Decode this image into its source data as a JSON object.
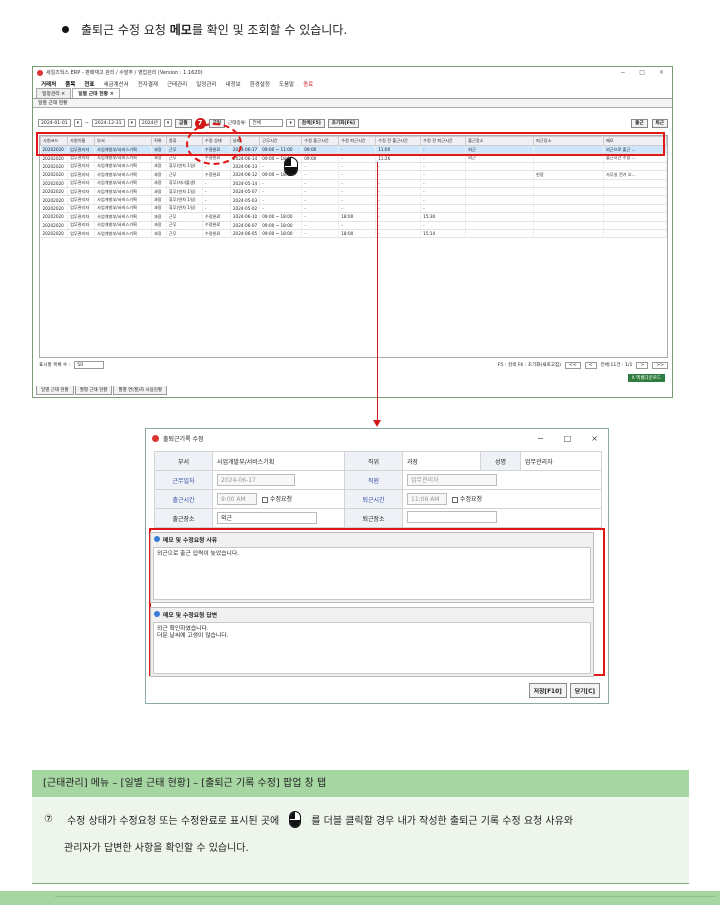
{
  "intro": {
    "text_pre": "출퇴근 수정 요청 ",
    "text_bold": "메모",
    "text_post": "를 확인 및 조회할 수 있습니다."
  },
  "erp": {
    "title": "세일즈웍스 ERP - 판매재고 관리 / 수발주 / 영업관리 (Version : 1.1620)",
    "window_controls": [
      "−",
      "□",
      "×"
    ],
    "menu": [
      "거래처",
      "품목",
      "전표",
      "세금계산서",
      "전자결재",
      "근태관리",
      "일정관리",
      "내정보",
      "환경설정",
      "도움말",
      "종료"
    ],
    "doc_tabs": [
      "일정관리",
      "일별 근태 현황"
    ],
    "panel_title": "일별 근태 현황",
    "filter": {
      "date_from": "2024-01-01",
      "tilde": "~",
      "date_to": "2024-12-31",
      "year": "2024년",
      "btn_year": "금월",
      "step": "7",
      "btn_today": "금일",
      "type_label": "근태종류:",
      "type_value": "전체",
      "btn_search": "검색[F5]",
      "btn_reset": "초기화[F6]",
      "btn_in": "출근",
      "btn_out": "퇴근"
    },
    "grid": {
      "columns": [
        "사원코드",
        "사원이름",
        "부서",
        "직위",
        "종류",
        "수정 상태",
        "날짜",
        "근무시간",
        "수정 출근시간",
        "수정 퇴근시간",
        "수정 전 출근시간",
        "수정 전 퇴근시간",
        "출근장소",
        "퇴근장소",
        "메모"
      ],
      "rows": [
        [
          "20202020",
          "업무관리자",
          "사업개발부/서비스기획",
          "과장",
          "근무",
          "수정완료",
          "2024-06-17",
          "09:00 ~ 11:00",
          "09:00",
          "-",
          "11:00",
          "-",
          "외근",
          "",
          "외근으로 출근 ..."
        ],
        [
          "20202020",
          "업무관리자",
          "사업개발부/서비스기획",
          "과장",
          "근무",
          "수정완료",
          "2024-06-14",
          "09:00 ~ 18:00",
          "09:00",
          "-",
          "11:26",
          "-",
          "외근",
          "",
          "출근시간 수정 ..."
        ],
        [
          "20202020",
          "업무관리자",
          "사업개발부/서비스기획",
          "과장",
          "휴무(연차 1일)",
          "-",
          "2024-06-13",
          "-",
          "-",
          "-",
          "-",
          "-",
          "",
          "",
          ""
        ],
        [
          "20202020",
          "업무관리자",
          "사업개발부/서비스기획",
          "과장",
          "근무",
          "수정완료",
          "2024-06-12",
          "09:00 ~ 18:00",
          "-",
          "-",
          "-",
          "-",
          "",
          "현장",
          "사무실 전기 오..."
        ],
        [
          "20202020",
          "업무관리자",
          "사업개발부/서비스기획",
          "과장",
          "휴무(자녀출생)",
          "-",
          "2024-05-14",
          "-",
          "-",
          "-",
          "-",
          "-",
          "",
          "",
          ""
        ],
        [
          "20202020",
          "업무관리자",
          "사업개발부/서비스기획",
          "과장",
          "휴무(연차 1일)",
          "-",
          "2024-05-07",
          "-",
          "-",
          "-",
          "-",
          "-",
          "",
          "",
          ""
        ],
        [
          "20202020",
          "업무관리자",
          "사업개발부/서비스기획",
          "과장",
          "휴무(연차 1일)",
          "-",
          "2024-05-03",
          "-",
          "-",
          "-",
          "-",
          "-",
          "",
          "",
          ""
        ],
        [
          "20202020",
          "업무관리자",
          "사업개발부/서비스기획",
          "과장",
          "휴무(연차 1일)",
          "-",
          "2024-05-02",
          "-",
          "-",
          "-",
          "-",
          "-",
          "",
          "",
          ""
        ],
        [
          "20202020",
          "업무관리자",
          "사업개발부/서비스기획",
          "과장",
          "근무",
          "수정완료",
          "2024-06-10",
          "09:00 ~ 18:00",
          "-",
          "18:00",
          "-",
          "15:30",
          "",
          "",
          ""
        ],
        [
          "20202020",
          "업무관리자",
          "사업개발부/서비스기획",
          "과장",
          "근무",
          "수정완료",
          "2024-06-07",
          "09:00 ~ 18:00",
          "-",
          "-",
          "-",
          "-",
          "",
          "",
          ""
        ],
        [
          "20202020",
          "업무관리자",
          "사업개발부/서비스기획",
          "과장",
          "근무",
          "수정완료",
          "2024-06-05",
          "09:00 ~ 18:00",
          "-",
          "18:00",
          "-",
          "15:14",
          "",
          "",
          ""
        ]
      ]
    },
    "footer": {
      "rows_label": "표시할 목록 수 :",
      "rows_value": "50",
      "hint": "F5 : 검색  F6 : 초기화(새로고침)",
      "nav_prev2": "<<",
      "nav_prev": "<",
      "total": "전체:11건 : 1/1",
      "nav_next": ">",
      "nav_next2": ">>",
      "excel": "엑셀다운로드"
    },
    "bottom_tabs": [
      "일별 근태 현황",
      "월별 근태 현황",
      "월별 연(월)차 사용현황"
    ]
  },
  "popup": {
    "title": "출퇴근기록 수정",
    "window_controls": [
      "−",
      "□",
      "×"
    ],
    "labels": {
      "dept": "부서",
      "position": "직위",
      "name": "성명",
      "workdate": "근무일자",
      "role": "직원",
      "in_time": "출근시간",
      "out_time": "퇴근시간",
      "in_place": "출근장소",
      "out_place": "퇴근장소"
    },
    "values": {
      "dept": "사업개발부/서비스기획",
      "position": "과장",
      "name": "업무관리자",
      "workdate": "2024-06-17",
      "role": "업무관리자",
      "in_time": "9:00 AM",
      "out_time": "11:06 AM",
      "edit_req": "수정요청",
      "in_place": "외근",
      "out_place": ""
    },
    "memo_reason_title": "메모 및 수정요청 사유",
    "memo_reason_text": "외근으로 출근 입력이 늦었습니다.",
    "memo_reply_title": "메모 및 수정요청 답변",
    "memo_reply_text": "외근 확인하였습니다.\n더운 날씨에 고생이 많습니다.",
    "btn_save": "저장[F10]",
    "btn_close": "닫기[C]"
  },
  "caption": {
    "header": "[근태관리] 메뉴 – [일별 근태 현황] – [출퇴근 기록 수정] 팝업 창 탭",
    "num": "⑦",
    "line1_pre": "수정 상태가 수정요청 또는 수정완료로  표시된  곳에",
    "line1_post": "를 더블 클릭할 경우  내가 작성한 출퇴근 기록 수정 요청 사유와",
    "line2": "관리자가 답변한 사항을 확인할 수 있습니다."
  },
  "colors": {
    "highlight": "#e01818",
    "caption_header": "#a6d7a2",
    "caption_body": "#eef6ec",
    "selected_row": "#cde6fb"
  }
}
